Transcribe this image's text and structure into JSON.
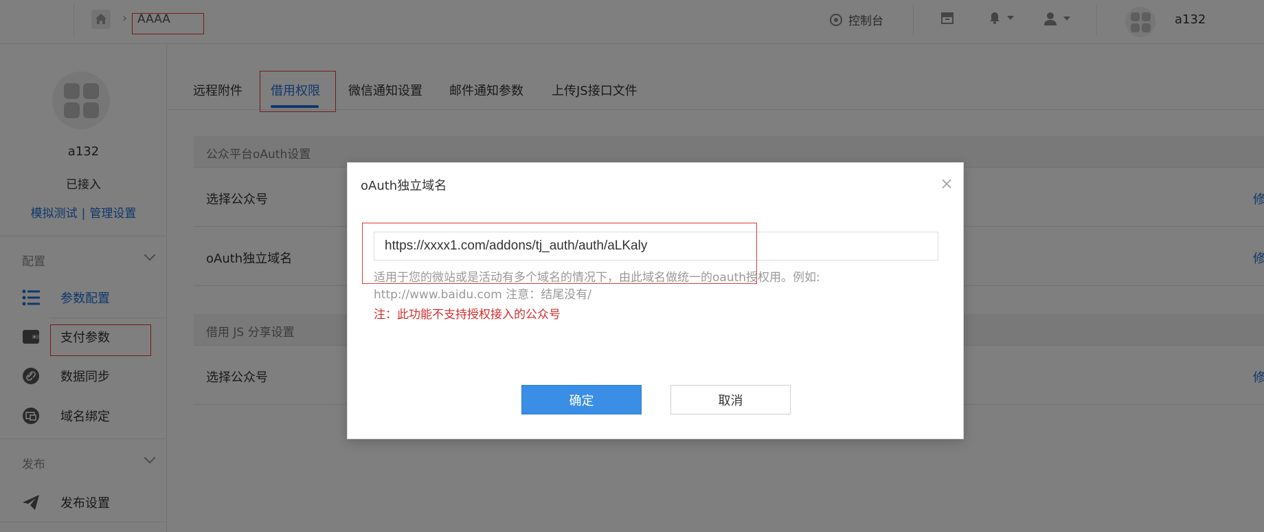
{
  "header": {
    "breadcrumb_current": "AAAA",
    "console_label": "控制台",
    "username": "a132"
  },
  "sidebar": {
    "account_name": "a132",
    "status": "已接入",
    "link_test": "模拟测试",
    "link_sep": "|",
    "link_manage": "管理设置",
    "group_config": "配置",
    "items": [
      {
        "label": "参数配置",
        "icon": "list-icon"
      },
      {
        "label": "支付参数",
        "icon": "wallet-icon"
      },
      {
        "label": "数据同步",
        "icon": "link-icon"
      },
      {
        "label": "域名绑定",
        "icon": "domain-icon"
      }
    ],
    "group_publish": "发布",
    "publish_item": {
      "label": "发布设置",
      "icon": "send-icon"
    }
  },
  "tabs": [
    {
      "label": "远程附件"
    },
    {
      "label": "借用权限"
    },
    {
      "label": "微信通知设置"
    },
    {
      "label": "邮件通知参数"
    },
    {
      "label": "上传JS接口文件"
    }
  ],
  "sections": {
    "oauth_title": "公众平台oAuth设置",
    "oauth_rows": [
      {
        "label": "选择公众号",
        "action": "修"
      },
      {
        "label": "oAuth独立域名",
        "action": "修"
      }
    ],
    "js_title": "借用 JS 分享设置",
    "js_rows": [
      {
        "label": "选择公众号",
        "action": "修"
      }
    ]
  },
  "modal": {
    "title": "oAuth独立域名",
    "close": "×",
    "input_value": "https://xxxx1.com/addons/tj_auth/auth/aLKaly",
    "help_text": "适用于您的微站或是活动有多个域名的情况下，由此域名做统一的oauth授权用。例如: http://www.baidu.com 注意：结尾没有/",
    "warning": "注：此功能不支持授权接入的公众号",
    "ok_label": "确定",
    "cancel_label": "取消"
  },
  "colors": {
    "primary": "#3a8ee6",
    "link": "#1e6fd9",
    "warning": "#d32f2f",
    "highlight_box": "#e53935"
  }
}
